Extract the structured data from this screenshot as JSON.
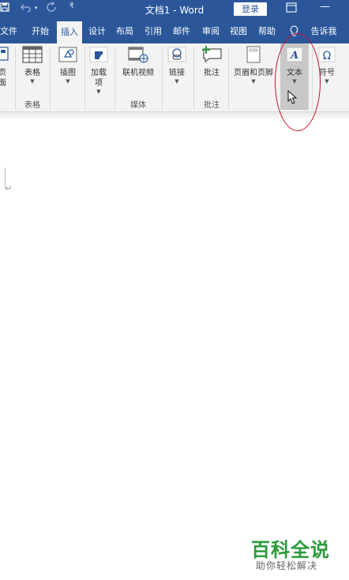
{
  "window": {
    "title": "文档1  -  Word",
    "login_label": "登录"
  },
  "tabs": [
    {
      "label": "文件",
      "active": false
    },
    {
      "label": "开始",
      "active": false
    },
    {
      "label": "插入",
      "active": true
    },
    {
      "label": "设计",
      "active": false
    },
    {
      "label": "布局",
      "active": false
    },
    {
      "label": "引用",
      "active": false
    },
    {
      "label": "邮件",
      "active": false
    },
    {
      "label": "审阅",
      "active": false
    },
    {
      "label": "视图",
      "active": false
    },
    {
      "label": "帮助",
      "active": false
    }
  ],
  "tell_me": "告诉我",
  "ribbon": {
    "pages": {
      "label": "页\n面"
    },
    "table": {
      "label": "表格"
    },
    "illustrations": {
      "label": "插图"
    },
    "addins": {
      "label": "加载\n项"
    },
    "online_video": {
      "label": "联机视频"
    },
    "links": {
      "label": "链接"
    },
    "comment": {
      "label": "批注"
    },
    "header_footer": {
      "label": "页眉和页脚"
    },
    "text": {
      "label": "文本"
    },
    "symbols": {
      "label": "符号"
    }
  },
  "groups": {
    "tables": "表格",
    "media": "媒体",
    "comments": "批注"
  },
  "document": {
    "paragraph_mark": "↵"
  },
  "watermark": {
    "title": "百科全说",
    "subtitle": "助你轻松解决"
  },
  "colors": {
    "word_blue": "#2b579a",
    "ribbon_bg": "#f3f3f3",
    "annotation_red": "#c8102e",
    "watermark_green": "#2a9a3a"
  }
}
